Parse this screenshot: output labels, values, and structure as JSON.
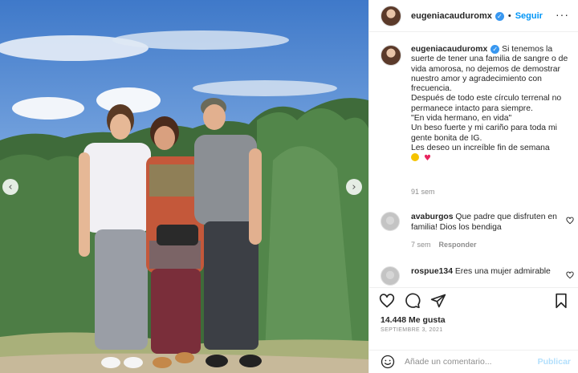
{
  "post": {
    "username": "eugeniacauduromx",
    "follow_label": "Seguir",
    "dot": "•",
    "more_label": "···"
  },
  "caption": {
    "username": "eugeniacauduromx",
    "text": " Si tenemos la suerte de tener una familia de sangre o de vida amorosa, no dejemos de demostrar nuestro amor y agradecimiento con frecuencia.\nDespués de todo este círculo terrenal no permanece intacto para siempre.\n\"En vida hermano, en vida\"\nUn beso fuerte y mi cariño para toda mi gente bonita de IG.\nLes deseo un increíble fin de semana",
    "heart_emoji": "♥",
    "time": "91 sem"
  },
  "comments": [
    {
      "username": "avaburgos",
      "text": " Que padre que disfruten en familia! Dios los bendiga",
      "time": "7 sem",
      "reply_label": "Responder"
    },
    {
      "username": "rospue134",
      "text": " Eres una mujer admirable"
    }
  ],
  "footer": {
    "likes": "14.448 Me gusta",
    "date": "SEPTIEMBRE 3, 2021",
    "comment_placeholder": "Añade un comentario...",
    "post_label": "Publicar"
  },
  "photo": {
    "prev_arrow": "‹",
    "next_arrow": "›"
  },
  "icons": {
    "verified": "verified-badge-icon",
    "like": "heart-icon",
    "comment": "comment-bubble-icon",
    "share": "paper-plane-icon",
    "save": "bookmark-icon",
    "emoji": "smiley-icon"
  },
  "colors": {
    "accent": "#0095f6",
    "verified": "#3897f0",
    "muted": "#8e8e8e",
    "post_disabled": "#b2dffc"
  }
}
